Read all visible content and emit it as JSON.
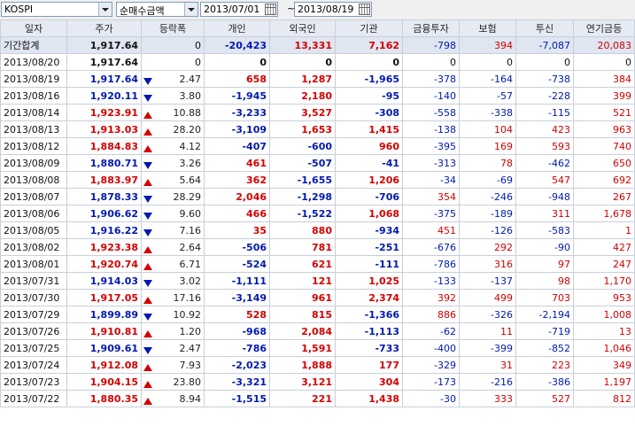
{
  "toolbar": {
    "market": "KOSPI",
    "metric": "순매수금액",
    "start_date": "2013/07/01",
    "separator": "~",
    "end_date": "2013/08/19"
  },
  "columns": [
    "일자",
    "주가",
    "등락폭",
    "개인",
    "외국인",
    "기관",
    "금융투자",
    "보험",
    "투신",
    "연기금등"
  ],
  "summary": {
    "date": "기간합계",
    "price": "1,917.64",
    "change": "0",
    "dir": "none",
    "individual": "-20,423",
    "foreign": "13,331",
    "institution": "7,162",
    "finance": "-798",
    "insurance": "394",
    "trust": "-7,087",
    "pension": "20,083"
  },
  "rows": [
    {
      "date": "2013/08/20",
      "price": "1,917.64",
      "change": "0",
      "dir": "none",
      "individual": "0",
      "foreign": "0",
      "institution": "0",
      "finance": "0",
      "insurance": "0",
      "trust": "0",
      "pension": "0"
    },
    {
      "date": "2013/08/19",
      "price": "1,917.64",
      "change": "2.47",
      "dir": "down",
      "individual": "658",
      "foreign": "1,287",
      "institution": "-1,965",
      "finance": "-378",
      "insurance": "-164",
      "trust": "-738",
      "pension": "384"
    },
    {
      "date": "2013/08/16",
      "price": "1,920.11",
      "change": "3.80",
      "dir": "down",
      "individual": "-1,945",
      "foreign": "2,180",
      "institution": "-95",
      "finance": "-140",
      "insurance": "-57",
      "trust": "-228",
      "pension": "399"
    },
    {
      "date": "2013/08/14",
      "price": "1,923.91",
      "change": "10.88",
      "dir": "up",
      "individual": "-3,233",
      "foreign": "3,527",
      "institution": "-308",
      "finance": "-558",
      "insurance": "-338",
      "trust": "-115",
      "pension": "521"
    },
    {
      "date": "2013/08/13",
      "price": "1,913.03",
      "change": "28.20",
      "dir": "up",
      "individual": "-3,109",
      "foreign": "1,653",
      "institution": "1,415",
      "finance": "-138",
      "insurance": "104",
      "trust": "423",
      "pension": "963"
    },
    {
      "date": "2013/08/12",
      "price": "1,884.83",
      "change": "4.12",
      "dir": "up",
      "individual": "-407",
      "foreign": "-600",
      "institution": "960",
      "finance": "-395",
      "insurance": "169",
      "trust": "593",
      "pension": "740"
    },
    {
      "date": "2013/08/09",
      "price": "1,880.71",
      "change": "3.26",
      "dir": "down",
      "individual": "461",
      "foreign": "-507",
      "institution": "-41",
      "finance": "-313",
      "insurance": "78",
      "trust": "-462",
      "pension": "650"
    },
    {
      "date": "2013/08/08",
      "price": "1,883.97",
      "change": "5.64",
      "dir": "up",
      "individual": "362",
      "foreign": "-1,655",
      "institution": "1,206",
      "finance": "-34",
      "insurance": "-69",
      "trust": "547",
      "pension": "692"
    },
    {
      "date": "2013/08/07",
      "price": "1,878.33",
      "change": "28.29",
      "dir": "down",
      "individual": "2,046",
      "foreign": "-1,298",
      "institution": "-706",
      "finance": "354",
      "insurance": "-246",
      "trust": "-948",
      "pension": "267"
    },
    {
      "date": "2013/08/06",
      "price": "1,906.62",
      "change": "9.60",
      "dir": "down",
      "individual": "466",
      "foreign": "-1,522",
      "institution": "1,068",
      "finance": "-375",
      "insurance": "-189",
      "trust": "311",
      "pension": "1,678"
    },
    {
      "date": "2013/08/05",
      "price": "1,916.22",
      "change": "7.16",
      "dir": "down",
      "individual": "35",
      "foreign": "880",
      "institution": "-934",
      "finance": "451",
      "insurance": "-126",
      "trust": "-583",
      "pension": "1"
    },
    {
      "date": "2013/08/02",
      "price": "1,923.38",
      "change": "2.64",
      "dir": "up",
      "individual": "-506",
      "foreign": "781",
      "institution": "-251",
      "finance": "-676",
      "insurance": "292",
      "trust": "-90",
      "pension": "427"
    },
    {
      "date": "2013/08/01",
      "price": "1,920.74",
      "change": "6.71",
      "dir": "up",
      "individual": "-524",
      "foreign": "621",
      "institution": "-111",
      "finance": "-786",
      "insurance": "316",
      "trust": "97",
      "pension": "247"
    },
    {
      "date": "2013/07/31",
      "price": "1,914.03",
      "change": "3.02",
      "dir": "down",
      "individual": "-1,111",
      "foreign": "121",
      "institution": "1,025",
      "finance": "-133",
      "insurance": "-137",
      "trust": "98",
      "pension": "1,170"
    },
    {
      "date": "2013/07/30",
      "price": "1,917.05",
      "change": "17.16",
      "dir": "up",
      "individual": "-3,149",
      "foreign": "961",
      "institution": "2,374",
      "finance": "392",
      "insurance": "499",
      "trust": "703",
      "pension": "953"
    },
    {
      "date": "2013/07/29",
      "price": "1,899.89",
      "change": "10.92",
      "dir": "down",
      "individual": "528",
      "foreign": "815",
      "institution": "-1,366",
      "finance": "886",
      "insurance": "-326",
      "trust": "-2,194",
      "pension": "1,008"
    },
    {
      "date": "2013/07/26",
      "price": "1,910.81",
      "change": "1.20",
      "dir": "up",
      "individual": "-968",
      "foreign": "2,084",
      "institution": "-1,113",
      "finance": "-62",
      "insurance": "11",
      "trust": "-719",
      "pension": "13"
    },
    {
      "date": "2013/07/25",
      "price": "1,909.61",
      "change": "2.47",
      "dir": "down",
      "individual": "-786",
      "foreign": "1,591",
      "institution": "-733",
      "finance": "-400",
      "insurance": "-399",
      "trust": "-852",
      "pension": "1,046"
    },
    {
      "date": "2013/07/24",
      "price": "1,912.08",
      "change": "7.93",
      "dir": "up",
      "individual": "-2,023",
      "foreign": "1,888",
      "institution": "177",
      "finance": "-329",
      "insurance": "31",
      "trust": "223",
      "pension": "349"
    },
    {
      "date": "2013/07/23",
      "price": "1,904.15",
      "change": "23.80",
      "dir": "up",
      "individual": "-3,321",
      "foreign": "3,121",
      "institution": "304",
      "finance": "-173",
      "insurance": "-216",
      "trust": "-386",
      "pension": "1,197"
    },
    {
      "date": "2013/07/22",
      "price": "1,880.35",
      "change": "8.94",
      "dir": "up",
      "individual": "-1,515",
      "foreign": "221",
      "institution": "1,438",
      "finance": "-30",
      "insurance": "333",
      "trust": "527",
      "pension": "812"
    }
  ],
  "colors": {
    "up": "#d40000",
    "down": "#0019b0",
    "header_bg": "#e6ebf3",
    "summary_bg": "#dfe6f1"
  },
  "icons": {
    "dropdown": "chevron-down-icon",
    "calendar": "calendar-icon",
    "up": "triangle-up-icon",
    "down": "triangle-down-icon"
  }
}
